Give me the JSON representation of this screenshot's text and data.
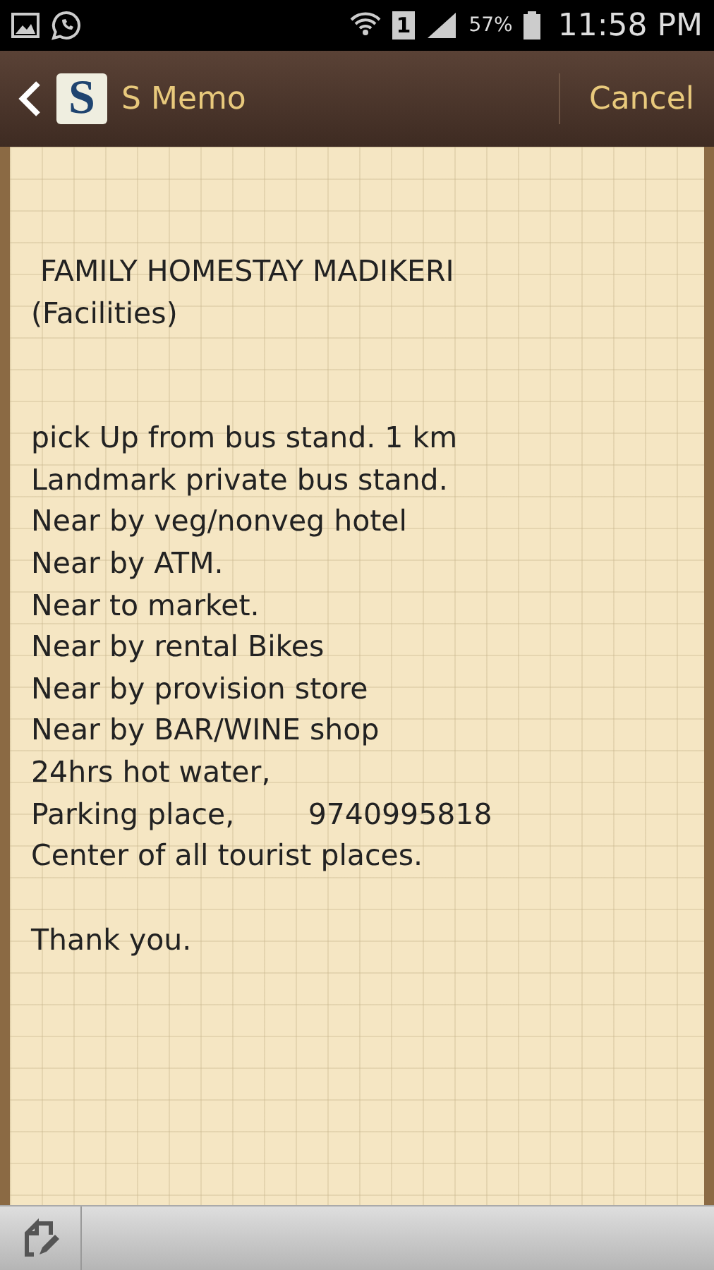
{
  "status_bar": {
    "battery": "57%",
    "time": "11:58 PM",
    "sim_slot": "1"
  },
  "header": {
    "app_icon_letter": "S",
    "title": "S Memo",
    "cancel": "Cancel"
  },
  "memo": {
    "paragraphs": [
      [
        " FAMILY HOMESTAY MADIKERI",
        "(Facilities)"
      ],
      [
        "pick Up from bus stand. 1 km",
        "Landmark private bus stand.",
        "Near by veg/nonveg hotel",
        "Near by ATM.",
        "Near to market.",
        "Near by rental Bikes",
        "Near by provision store",
        "Near by BAR/WINE shop",
        "24hrs hot water,",
        "Parking place,        9740995818",
        "Center of all tourist places."
      ],
      [
        "Thank you."
      ]
    ]
  }
}
